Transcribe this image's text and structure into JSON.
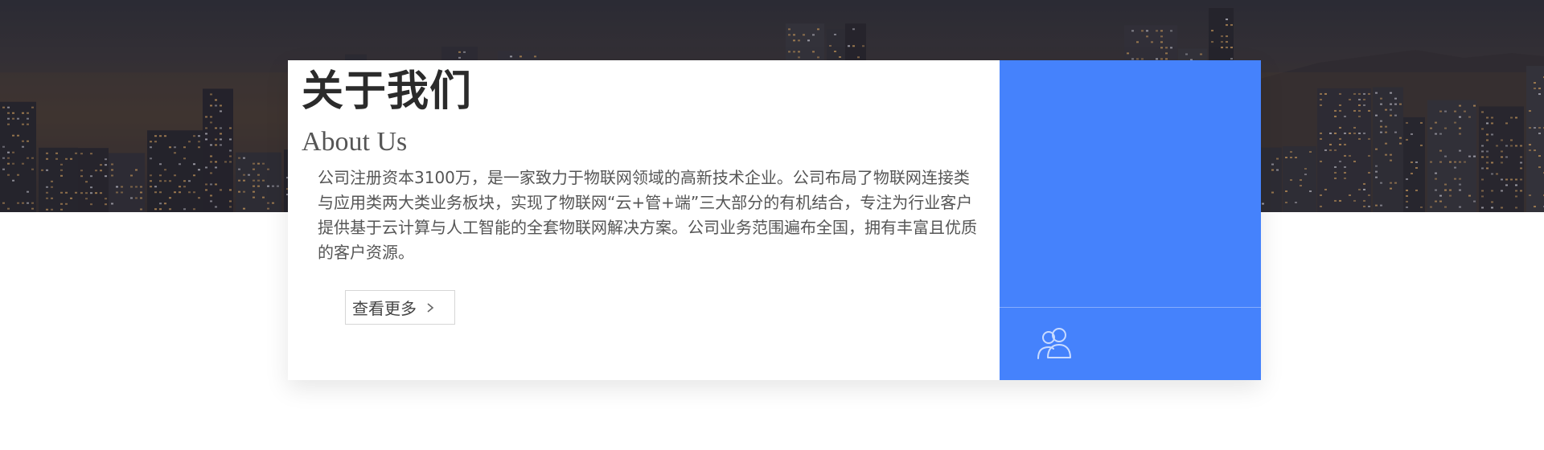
{
  "banner": {
    "image": "night-city-skyline"
  },
  "about": {
    "title": "关于我们",
    "subtitle": "About Us",
    "description": "公司注册资本3100万，是一家致力于物联网领域的高新技术企业。公司布局了物联网连接类与应用类两大类业务板块，实现了物联网“云+管+端”三大部分的有机结合，专注为行业客户提供基于云计算与人工智能的全套物联网解决方案。公司业务范围遍布全国，拥有丰富且优质的客户资源。",
    "more_label": "查看更多",
    "more_icon": "chevron-right-icon"
  },
  "side_panel": {
    "color": "#4582fc",
    "icon": "users-icon"
  },
  "colors": {
    "title": "#2b2b2b",
    "text": "#555555",
    "accent": "#4582fc"
  }
}
